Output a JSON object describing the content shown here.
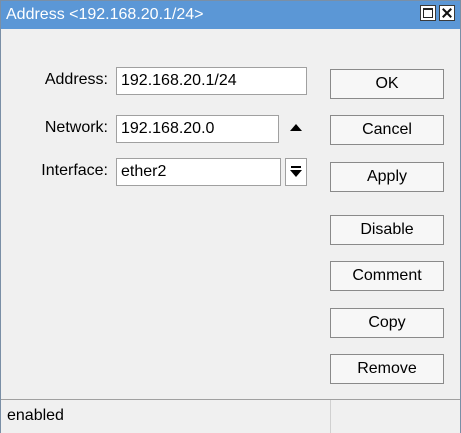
{
  "window": {
    "title": "Address <192.168.20.1/24>"
  },
  "form": {
    "address": {
      "label": "Address:",
      "value": "192.168.20.1/24"
    },
    "network": {
      "label": "Network:",
      "value": "192.168.20.0"
    },
    "interface": {
      "label": "Interface:",
      "value": "ether2"
    }
  },
  "buttons": {
    "ok": "OK",
    "cancel": "Cancel",
    "apply": "Apply",
    "disable": "Disable",
    "comment": "Comment",
    "copy": "Copy",
    "remove": "Remove"
  },
  "status": {
    "text": "enabled"
  },
  "colors": {
    "titlebar": "#5b97d6",
    "window_bg": "#f0f0f0"
  },
  "icons": {
    "maximize": "maximize-icon",
    "close": "close-icon",
    "network_toggle": "up-arrow-icon",
    "interface_dropdown": "dropdown-arrow-icon"
  }
}
